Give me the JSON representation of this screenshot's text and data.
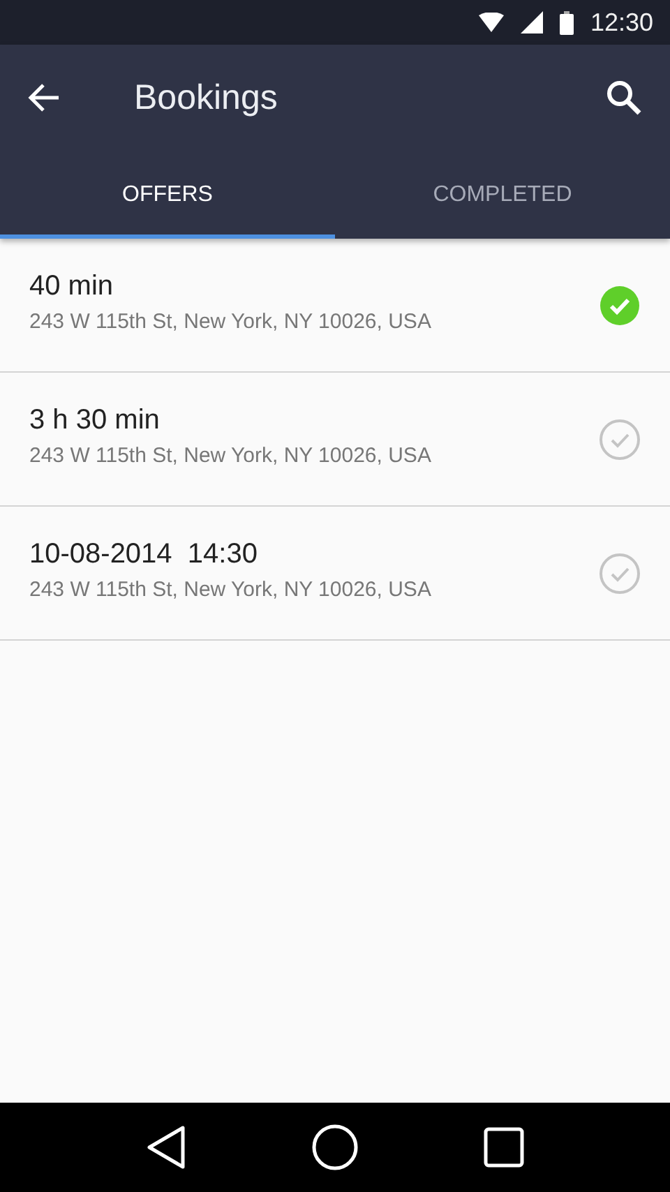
{
  "status_bar": {
    "time": "12:30"
  },
  "app_bar": {
    "title": "Bookings"
  },
  "tabs": [
    {
      "label": "OFFERS",
      "selected": true
    },
    {
      "label": "COMPLETED",
      "selected": false
    }
  ],
  "bookings": [
    {
      "title": "40 min",
      "address": "243 W 115th St, New York, NY 10026, USA",
      "checked": true
    },
    {
      "title": "3 h 30 min",
      "address": "243 W 115th St, New York, NY 10026, USA",
      "checked": false
    },
    {
      "title": "10-08-2014  14:30",
      "address": "243 W 115th St, New York, NY 10026, USA",
      "checked": false
    }
  ]
}
